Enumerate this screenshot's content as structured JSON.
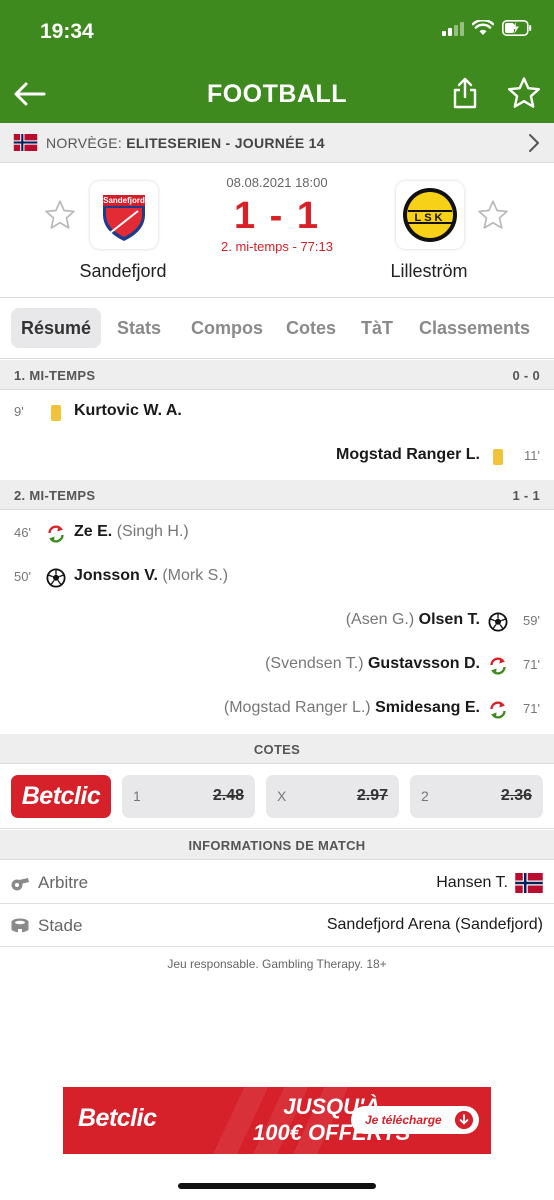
{
  "status_bar": {
    "time": "19:34"
  },
  "header": {
    "title": "FOOTBALL",
    "icons": [
      "back-arrow-icon",
      "share-icon",
      "star-icon"
    ]
  },
  "league": {
    "country": "NORVÈGE:",
    "competition": "ELITESERIEN - JOURNÉE 14"
  },
  "match": {
    "date": "08.08.2021 18:00",
    "score": "1 - 1",
    "status": "2. mi-temps - 77:13",
    "home_team": "Sandefjord",
    "away_team": "Lilleström",
    "home_crest_text": "Sandefjord",
    "away_crest_text": "LSK"
  },
  "tabs": [
    "Résumé",
    "Stats",
    "Compos",
    "Cotes",
    "TàT",
    "Classements"
  ],
  "first_half": {
    "label": "1. MI-TEMPS",
    "score": "0 - 0",
    "events": [
      {
        "side": "home",
        "minute": "9'",
        "type": "yellow-card",
        "player": "Kurtovic W. A.",
        "extra": ""
      },
      {
        "side": "away",
        "minute": "11'",
        "type": "yellow-card",
        "player": "Mogstad Ranger L.",
        "extra": ""
      }
    ]
  },
  "second_half": {
    "label": "2. MI-TEMPS",
    "score": "1 - 1",
    "events": [
      {
        "side": "home",
        "minute": "46'",
        "type": "substitution",
        "player": "Ze E.",
        "extra": "(Singh H.)"
      },
      {
        "side": "home",
        "minute": "50'",
        "type": "goal",
        "player": "Jonsson V.",
        "extra": "(Mork S.)"
      },
      {
        "side": "away",
        "minute": "59'",
        "type": "goal",
        "player": "Olsen T.",
        "extra": "(Asen G.)"
      },
      {
        "side": "away",
        "minute": "71'",
        "type": "substitution",
        "player": "Gustavsson D.",
        "extra": "(Svendsen T.)"
      },
      {
        "side": "away",
        "minute": "71'",
        "type": "substitution",
        "player": "Smidesang E.",
        "extra": "(Mogstad Ranger L.)"
      }
    ]
  },
  "odds": {
    "title": "COTES",
    "bookmaker": "Betclic",
    "items": [
      {
        "key": "1",
        "value": "2.48"
      },
      {
        "key": "X",
        "value": "2.97"
      },
      {
        "key": "2",
        "value": "2.36"
      }
    ]
  },
  "match_info": {
    "title": "INFORMATIONS DE MATCH",
    "referee_label": "Arbitre",
    "referee_value": "Hansen T.",
    "stadium_label": "Stade",
    "stadium_value": "Sandefjord Arena (Sandefjord)"
  },
  "disclaimer": "Jeu responsable. Gambling Therapy. 18+",
  "ad": {
    "brand": "Betclic",
    "line1": "JUSQU'À",
    "line2": "100€ OFFERTS",
    "cta": "Je télécharge"
  },
  "colors": {
    "header_green": "#3e8a1e",
    "score_red": "#d92027",
    "betclic_red": "#d6202a",
    "yellow_card": "#f2c33a"
  }
}
